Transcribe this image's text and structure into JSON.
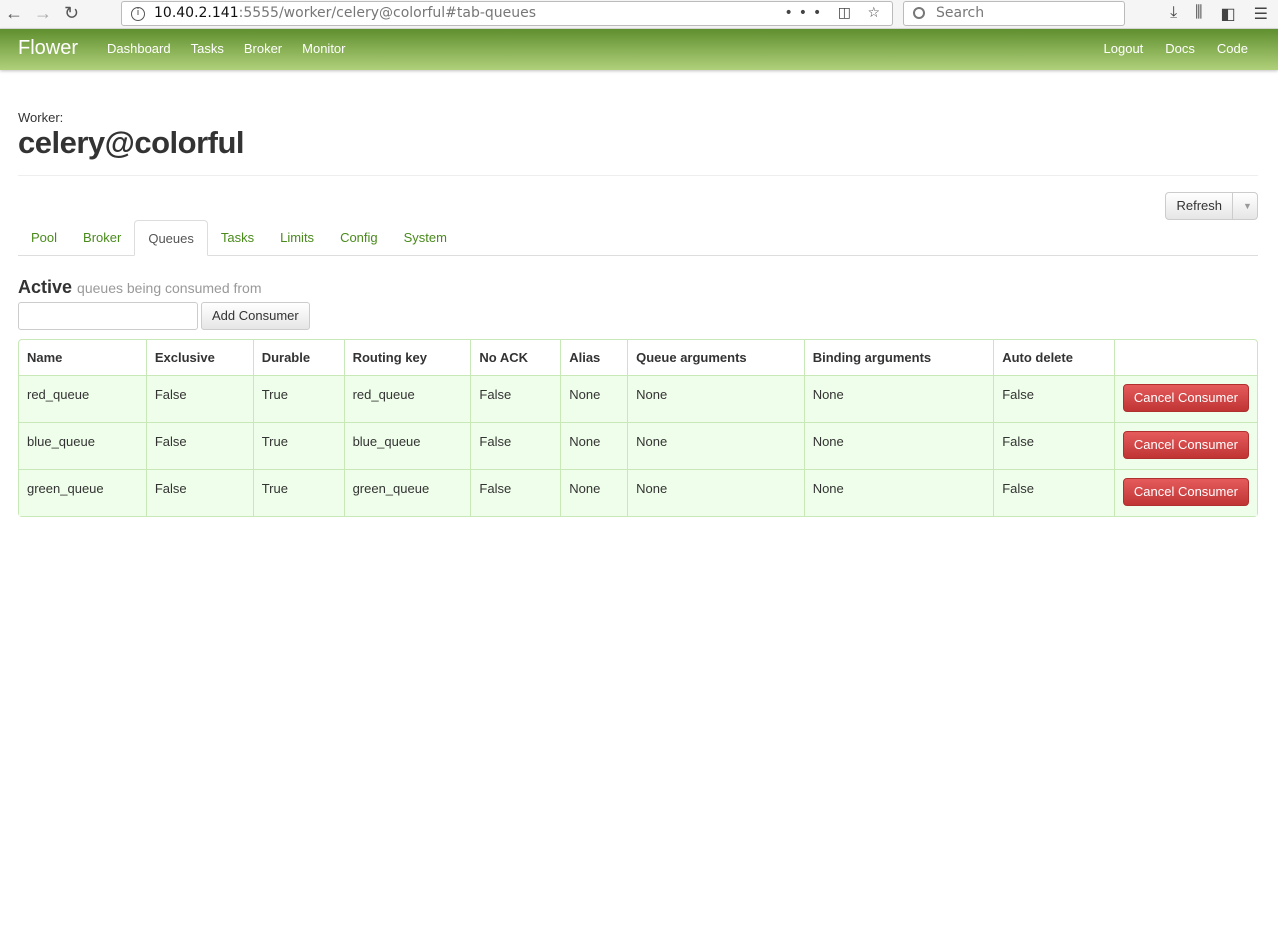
{
  "browser": {
    "url_host": "10.40.2.141",
    "url_rest": ":5555/worker/celery@colorful#tab-queues",
    "search_placeholder": "Search"
  },
  "navbar": {
    "brand": "Flower",
    "left": [
      "Dashboard",
      "Tasks",
      "Broker",
      "Monitor"
    ],
    "right": [
      "Logout",
      "Docs",
      "Code"
    ]
  },
  "worker": {
    "label": "Worker:",
    "name": "celery@colorful"
  },
  "refresh_label": "Refresh",
  "tabs": [
    "Pool",
    "Broker",
    "Queues",
    "Tasks",
    "Limits",
    "Config",
    "System"
  ],
  "active_tab": "Queues",
  "section": {
    "title": "Active",
    "subtitle": "queues being consumed from",
    "add_label": "Add Consumer",
    "input_value": ""
  },
  "table": {
    "headers": [
      "Name",
      "Exclusive",
      "Durable",
      "Routing key",
      "No ACK",
      "Alias",
      "Queue arguments",
      "Binding arguments",
      "Auto delete",
      ""
    ],
    "rows": [
      [
        "red_queue",
        "False",
        "True",
        "red_queue",
        "False",
        "None",
        "None",
        "None",
        "False"
      ],
      [
        "blue_queue",
        "False",
        "True",
        "blue_queue",
        "False",
        "None",
        "None",
        "None",
        "False"
      ],
      [
        "green_queue",
        "False",
        "True",
        "green_queue",
        "False",
        "None",
        "None",
        "None",
        "False"
      ]
    ],
    "action_label": "Cancel Consumer"
  }
}
